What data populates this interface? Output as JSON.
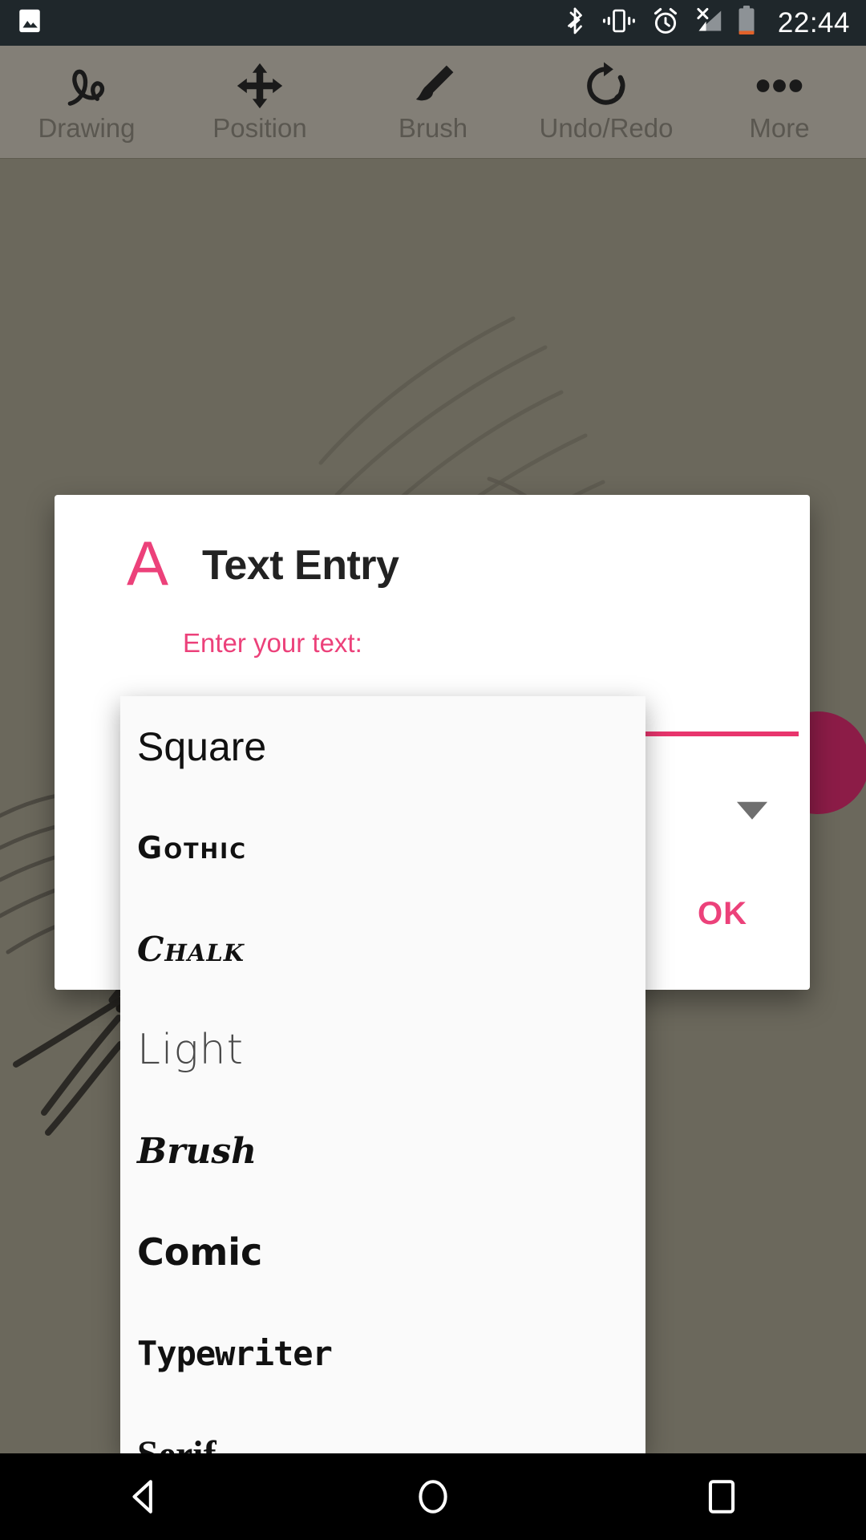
{
  "status_bar": {
    "time": "22:44",
    "background": "#1f272b",
    "left_icons": [
      {
        "name": "gallery-image-icon",
        "label": "Image"
      }
    ],
    "right_icons": [
      {
        "name": "bluetooth-icon",
        "label": "Bluetooth"
      },
      {
        "name": "vibrate-icon",
        "label": "Vibrate"
      },
      {
        "name": "alarm-icon",
        "label": "Alarm set"
      },
      {
        "name": "signal-no-sim-icon",
        "label": "No signal"
      },
      {
        "name": "battery-low-icon",
        "label": "Battery low"
      }
    ]
  },
  "toolbar": {
    "background": "#837f77",
    "label_color": "#5a5750",
    "items": [
      {
        "label": "Drawing",
        "icon": "scribble-icon"
      },
      {
        "label": "Position",
        "icon": "move-arrows-icon"
      },
      {
        "label": "Brush",
        "icon": "paintbrush-icon"
      },
      {
        "label": "Undo/Redo",
        "icon": "undo-redo-icon"
      },
      {
        "label": "More",
        "icon": "more-dots-icon"
      }
    ]
  },
  "canvas": {
    "background": "#6b685c",
    "fab_color": "#8c1c47"
  },
  "dialog": {
    "icon_glyph": "A",
    "accent": "#ec417a",
    "title": "Text Entry",
    "subtitle": "Enter your text:",
    "input_value": "",
    "input_placeholder": "",
    "ok_label": "OK"
  },
  "dropdown": {
    "background": "#fafafa",
    "items": [
      {
        "label": "Square",
        "style": "f-square"
      },
      {
        "label": "Gothic",
        "style": "f-gothic"
      },
      {
        "label": "Chalk",
        "style": "f-chalk"
      },
      {
        "label": "Light",
        "style": "f-light"
      },
      {
        "label": "Brush",
        "style": "f-brush"
      },
      {
        "label": "Comic",
        "style": "f-comic"
      },
      {
        "label": "Typewriter",
        "style": "f-typewriter"
      },
      {
        "label": "Serif",
        "style": "f-serif"
      }
    ]
  },
  "nav_bar": {
    "background": "#000000",
    "buttons": [
      {
        "name": "back-button",
        "label": "Back"
      },
      {
        "name": "home-button",
        "label": "Home"
      },
      {
        "name": "recents-button",
        "label": "Recents"
      }
    ]
  }
}
